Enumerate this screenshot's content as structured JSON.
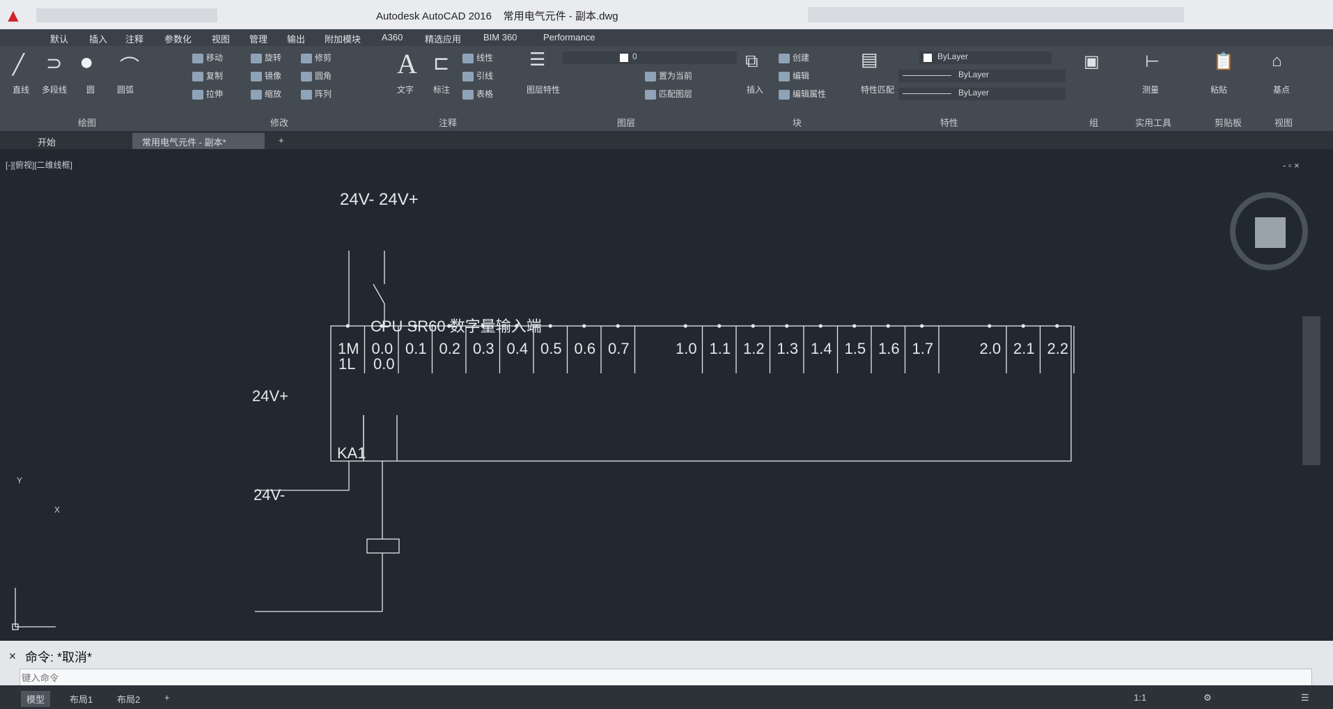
{
  "titlebar": {
    "app_title": "Autodesk AutoCAD 2016    常用电气元件 - 副本.dwg",
    "search_placeholder": "",
    "user": ""
  },
  "menubar": {
    "items": [
      "默认",
      "插入",
      "注释",
      "参数化",
      "视图",
      "管理",
      "输出",
      "附加模块",
      "A360",
      "精选应用",
      "BIM 360",
      "Performance"
    ]
  },
  "ribbon": {
    "draw": {
      "label": "绘图",
      "line": "直线",
      "polyline": "多段线",
      "circle": "圆",
      "arc": "圆弧"
    },
    "modify": {
      "label": "修改",
      "move": "移动",
      "rotate": "旋转",
      "trim": "修剪",
      "copy": "复制",
      "mirror": "镜像",
      "fillet": "圆角",
      "stretch": "拉伸",
      "scale": "缩放",
      "array": "阵列"
    },
    "annotation": {
      "label": "注释",
      "text": "文字",
      "dim": "标注",
      "linear": "线性",
      "leader": "引线",
      "table": "表格"
    },
    "layers": {
      "label": "图层",
      "layer_props": "图层特性",
      "current": "0",
      "make_current": "置为当前",
      "match_layer": "匹配图层"
    },
    "block": {
      "label": "块",
      "insert": "插入",
      "create": "创建",
      "edit": "编辑",
      "edit_attr": "编辑属性"
    },
    "properties": {
      "label": "特性",
      "match": "特性匹配",
      "color": "ByLayer",
      "linetype": "ByLayer",
      "lineweight": "ByLayer"
    },
    "groups": {
      "label": "组"
    },
    "utilities": {
      "label": "实用工具",
      "measure": "测量"
    },
    "clipboard": {
      "label": "剪贴板",
      "paste": "粘贴"
    },
    "view": {
      "label": "视图",
      "base": "基点"
    }
  },
  "tabs": {
    "start": "开始",
    "drawing": "常用电气元件 - 副本*",
    "add": "+"
  },
  "viewport": {
    "label": "[-][俯视][二维线框]",
    "controls": "- ▫ ×"
  },
  "drawing": {
    "top_label": "24V- 24V+",
    "module_title": "CPU SR60  数字量输入端",
    "terminals": [
      "1M",
      "0.0",
      "0.1",
      "0.2",
      "0.3",
      "0.4",
      "0.5",
      "0.6",
      "0.7",
      "1.0",
      "1.1",
      "1.2",
      "1.3",
      "1.4",
      "1.5",
      "1.6",
      "1.7",
      "2.0",
      "2.1",
      "2.2"
    ],
    "bottom_terminals": [
      "1L",
      "0.0"
    ],
    "supply_plus": "24V+",
    "supply_minus": "24V-",
    "relay": "KA1",
    "ucs_x": "X",
    "ucs_y": "Y"
  },
  "command": {
    "history": "命令: *取消*",
    "prompt_placeholder": "键入命令"
  },
  "status": {
    "model": "模型",
    "layout1": "布局1",
    "layout2": "布局2",
    "add": "+",
    "scale": "1:1"
  }
}
